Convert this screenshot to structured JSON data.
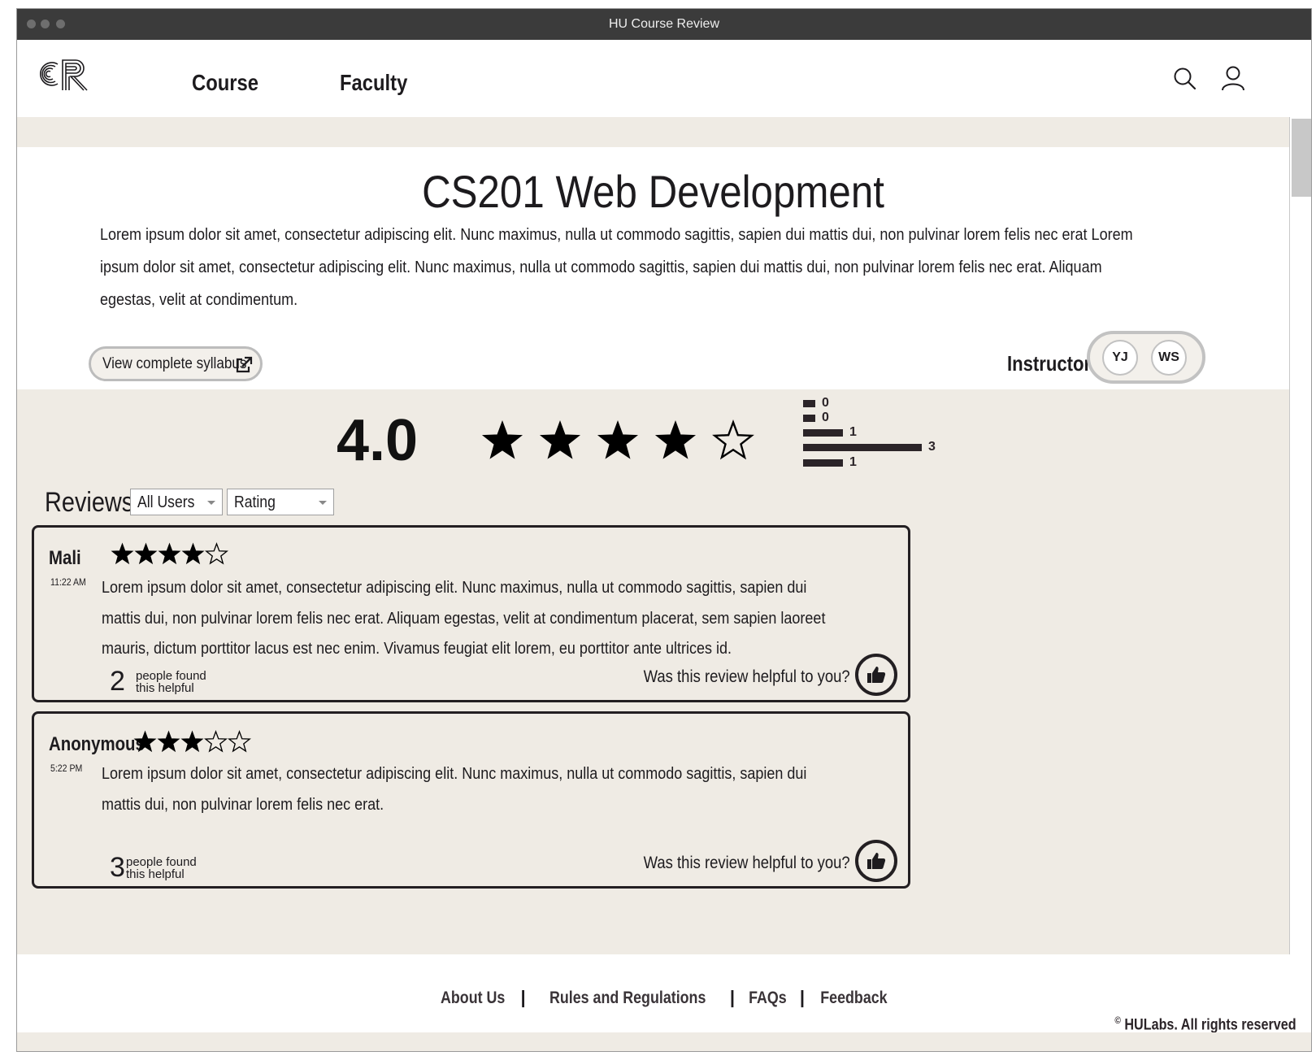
{
  "window": {
    "title": "HU Course Review"
  },
  "navbar": {
    "logo_text": "CR",
    "links": [
      {
        "label": "Course"
      },
      {
        "label": "Faculty"
      }
    ],
    "icons": [
      "search-icon",
      "user-icon"
    ]
  },
  "course": {
    "title": "CS201 Web Development",
    "description": "Lorem ipsum dolor sit amet, consectetur adipiscing elit. Nunc maximus, nulla ut commodo sagittis, sapien dui mattis dui, non pulvinar lorem felis nec erat Lorem ipsum dolor sit amet, consectetur adipiscing elit. Nunc maximus, nulla ut commodo sagittis, sapien dui mattis dui, non pulvinar lorem felis nec erat. Aliquam egestas, velit at condimentum.",
    "syllabus_button": "View complete syllabus",
    "instructors_label": "Instructors",
    "instructors": [
      "YJ",
      "WS"
    ]
  },
  "rating": {
    "average": "4.0",
    "stars": 4,
    "max_stars": 5,
    "distribution": [
      {
        "count": "0",
        "value": 0
      },
      {
        "count": "0",
        "value": 0
      },
      {
        "count": "1",
        "value": 1
      },
      {
        "count": "3",
        "value": 3
      },
      {
        "count": "1",
        "value": 1
      }
    ]
  },
  "reviews": {
    "heading": "Reviews",
    "filters": {
      "users": "All Users",
      "sort": "Rating"
    },
    "items": [
      {
        "author": "Mali",
        "time": "11:22 AM",
        "stars": 4,
        "text": "Lorem ipsum dolor sit amet, consectetur adipiscing elit. Nunc maximus, nulla ut commodo sagittis, sapien dui mattis dui, non pulvinar lorem felis nec erat. Aliquam egestas, velit at condimentum placerat, sem sapien laoreet mauris, dictum porttitor lacus est nec enim. Vivamus feugiat elit lorem, eu porttitor ante ultrices id.",
        "helpful_count": "2",
        "helpful_label": "people found this helpful",
        "helpful_question": "Was this review helpful to you?"
      },
      {
        "author": "Anonymous",
        "time": "5:22 PM",
        "stars": 3,
        "text": "Lorem ipsum dolor sit amet, consectetur adipiscing elit. Nunc maximus, nulla ut commodo sagittis, sapien dui mattis dui, non pulvinar lorem felis nec erat.",
        "helpful_count": "3",
        "helpful_label": "people found this helpful",
        "helpful_question": "Was this review helpful to you?"
      }
    ]
  },
  "footer": {
    "links": [
      {
        "label": "About Us"
      },
      {
        "label": "Rules and Regulations"
      },
      {
        "label": "FAQs"
      },
      {
        "label": "Feedback"
      }
    ],
    "separator": "|",
    "copyright_symbol": "©",
    "copyright": "HULabs.  All rights reserved"
  }
}
